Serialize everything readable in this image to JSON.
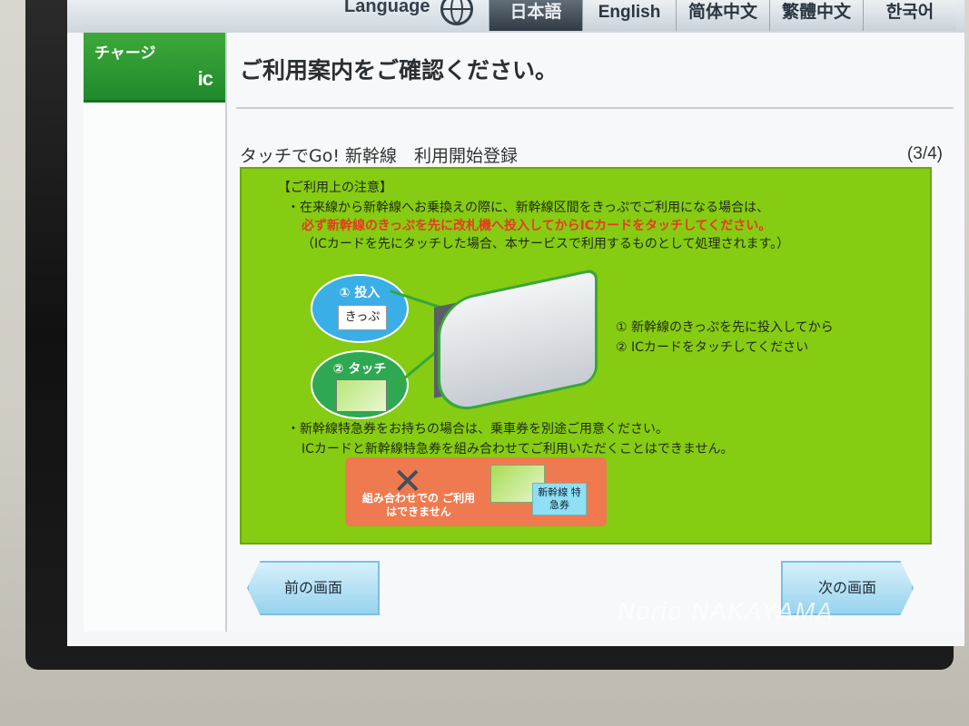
{
  "language_bar": {
    "label": "Language",
    "tabs": [
      "日本語",
      "English",
      "简体中文",
      "繁體中文",
      "한국어"
    ]
  },
  "sidebar": {
    "charge_label": "チャージ",
    "ic_logo_text": "ic"
  },
  "main": {
    "page_title": "ご利用案内をご確認ください。",
    "section_title": "タッチでGo! 新幹線　利用開始登録",
    "page_indicator": "(3/4)"
  },
  "panel": {
    "notice_heading": "【ご利用上の注意】",
    "bullet1": "・在来線から新幹線へお乗換えの際に、新幹線区間をきっぷでご利用になる場合は、",
    "bullet1_red": "必ず新幹線のきっぷを先に改札機へ投入してからICカードをタッチしてください。",
    "bullet1_note": "（ICカードを先にタッチした場合、本サービスで利用するものとして処理されます。）",
    "bubble_insert_title": "① 投入",
    "bubble_insert_ticket": "きっぷ",
    "bubble_touch_title": "② タッチ",
    "step1": "① 新幹線のきっぷを先に投入してから",
    "step2": "② ICカードをタッチしてください",
    "bullet2": "・新幹線特急券をお持ちの場合は、乗車券を別途ご用意ください。",
    "bullet2_line2": "ICカードと新幹線特急券を組み合わせてご利用いただくことはできません。",
    "warning_text": "組み合わせでの ご利用はできません",
    "express_ticket": "新幹線 特急券"
  },
  "nav": {
    "prev_label": "前の画面",
    "next_label": "次の画面"
  },
  "watermark": "Norio NAKAYAMA"
}
